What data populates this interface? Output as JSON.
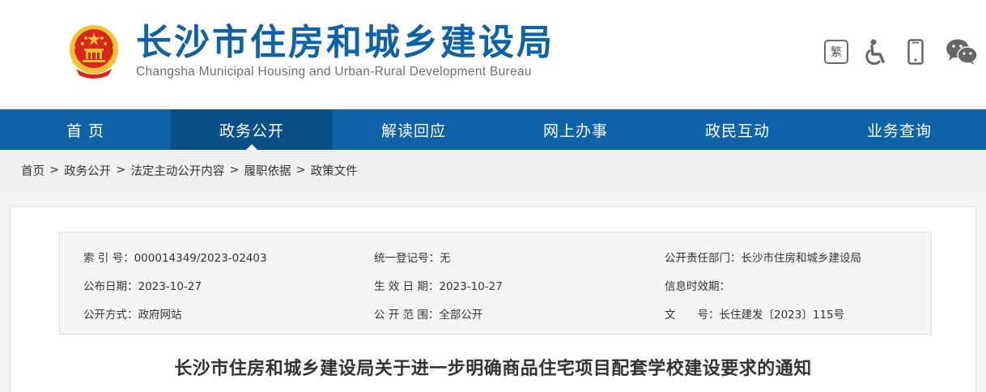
{
  "header": {
    "title": "长沙市住房和城乡建设局",
    "subtitle": "Changsha Municipal Housing and Urban-Rural Development Bureau",
    "tools": {
      "traditional_label": "繁"
    },
    "emblem_icon": "national-emblem-icon"
  },
  "nav": {
    "items": [
      {
        "label": "首 页"
      },
      {
        "label": "政务公开"
      },
      {
        "label": "解读回应"
      },
      {
        "label": "网上办事"
      },
      {
        "label": "政民互动"
      },
      {
        "label": "业务查询"
      }
    ],
    "active_index": 1
  },
  "breadcrumb": {
    "items": [
      "首页",
      "政务公开",
      "法定主动公开内容",
      "履职依据",
      "政策文件"
    ],
    "separator": ">"
  },
  "info": {
    "rows": [
      [
        "索 引 号：000014349/2023-02403",
        "统一登记号：无",
        "公开责任部门：长沙市住房和城乡建设局"
      ],
      [
        "公布日期：2023-10-27",
        "生 效 日 期：2023-10-27",
        "信息时效期："
      ],
      [
        "公开方式：政府网站",
        "公 开 范 围：全部公开",
        "文　　号：长住建发〔2023〕115号"
      ]
    ]
  },
  "document": {
    "title": "长沙市住房和城乡建设局关于进一步明确商品住宅项目配套学校建设要求的通知"
  },
  "colors": {
    "brand_blue": "#0d62a8",
    "nav_active": "#0a5088",
    "emblem_red": "#d8261c",
    "emblem_gold": "#f2c230"
  }
}
